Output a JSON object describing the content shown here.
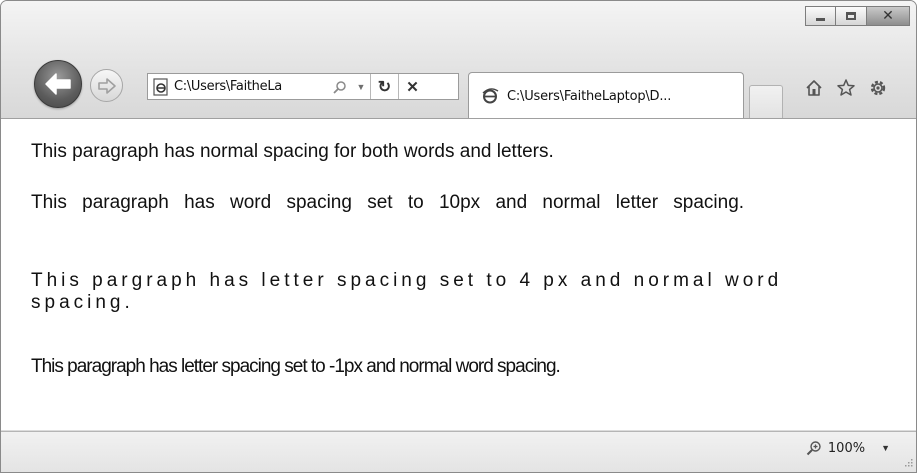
{
  "window": {
    "caption_buttons": [
      "minimize",
      "maximize",
      "close"
    ]
  },
  "navigation": {
    "back_icon": "back-arrow-icon",
    "forward_icon": "forward-arrow-icon"
  },
  "address_bar": {
    "url_text": "C:\\Users\\FaitheLa",
    "page_icon": "ie-page-icon",
    "search_icon": "search-icon",
    "dropdown_icon": "chevron-down-icon",
    "refresh_glyph": "↻",
    "stop_glyph": "✕"
  },
  "tabs": [
    {
      "label": "C:\\Users\\FaitheLaptop\\D...",
      "icon": "ie-logo-icon"
    }
  ],
  "toolbar": {
    "home_icon": "home-icon",
    "favorites_icon": "star-icon",
    "tools_icon": "gear-icon"
  },
  "content": {
    "paragraphs": [
      "This paragraph has normal spacing for both words and letters.",
      "This paragraph has word spacing set to 10px and normal letter spacing.",
      "This pargraph has letter spacing set to 4 px and normal word spacing.",
      "This paragraph has letter spacing set to -1px and normal word spacing."
    ]
  },
  "status_bar": {
    "zoom_icon": "zoom-icon",
    "zoom_level": "100%"
  },
  "colors": {
    "chrome": "#e2e2e2",
    "content_bg": "#ffffff",
    "text": "#111111"
  }
}
